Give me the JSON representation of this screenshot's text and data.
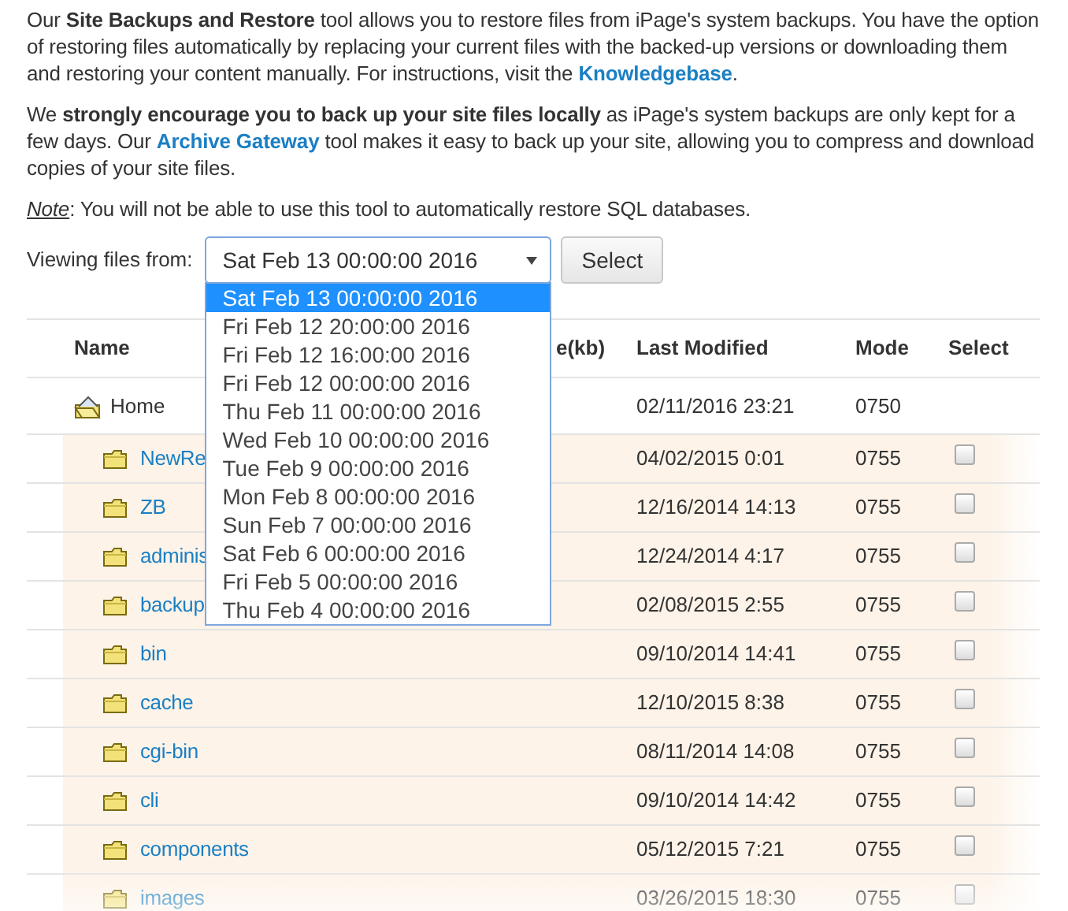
{
  "paragraphs": [
    {
      "segments": [
        {
          "kind": "text",
          "text": "Our **Site Backups and Restore** tool allows you to restore files from iPage's system backups. You have the option of restoring files automatically by replacing your current files with the backed-up versions or downloading them and restoring your content manually. For instructions, visit the "
        },
        {
          "kind": "link",
          "text": "Knowledgebase"
        },
        {
          "kind": "text",
          "text": "."
        }
      ]
    },
    {
      "segments": [
        {
          "kind": "text",
          "text": "We **strongly encourage you to back up your site files locally** as iPage's system backups are only kept for a few days. Our "
        },
        {
          "kind": "link",
          "text": "Archive Gateway"
        },
        {
          "kind": "text",
          "text": " tool makes it easy to back up your site, allowing you to compress and download copies of your site files."
        }
      ]
    },
    {
      "segments": [
        {
          "kind": "note-label",
          "text": "Note"
        },
        {
          "kind": "text",
          "text": ": You will not be able to use this tool to automatically restore SQL databases."
        }
      ]
    }
  ],
  "picker": {
    "label": "Viewing files from:",
    "value": "Sat Feb 13 00:00:00 2016",
    "expanded": true,
    "button": "Select",
    "options": [
      {
        "text": "Sat Feb 13 00:00:00 2016",
        "selected": true
      },
      {
        "text": "Fri Feb 12 20:00:00 2016",
        "selected": false
      },
      {
        "text": "Fri Feb 12 16:00:00 2016",
        "selected": false
      },
      {
        "text": "Fri Feb 12 00:00:00 2016",
        "selected": false
      },
      {
        "text": "Thu Feb 11 00:00:00 2016",
        "selected": false
      },
      {
        "text": "Wed Feb 10 00:00:00 2016",
        "selected": false
      },
      {
        "text": "Tue Feb 9 00:00:00 2016",
        "selected": false
      },
      {
        "text": "Mon Feb 8 00:00:00 2016",
        "selected": false
      },
      {
        "text": "Sun Feb 7 00:00:00 2016",
        "selected": false
      },
      {
        "text": "Sat Feb 6 00:00:00 2016",
        "selected": false
      },
      {
        "text": "Fri Feb 5 00:00:00 2016",
        "selected": false
      },
      {
        "text": "Thu Feb 4 00:00:00 2016",
        "selected": false
      }
    ]
  },
  "table": {
    "columns": [
      "Name",
      "e(kb)",
      "Last Modified",
      "Mode",
      "Select"
    ],
    "rows": [
      {
        "kind": "home",
        "name": "Home",
        "modified": "02/11/2016 23:21",
        "mode": "0750"
      },
      {
        "kind": "folder",
        "name": "NewRe",
        "modified": "04/02/2015 0:01",
        "mode": "0755",
        "checked": false
      },
      {
        "kind": "folder",
        "name": "ZB",
        "modified": "12/16/2014 14:13",
        "mode": "0755",
        "checked": false
      },
      {
        "kind": "folder",
        "name": "adminis",
        "modified": "12/24/2014 4:17",
        "mode": "0755",
        "checked": false
      },
      {
        "kind": "folder",
        "name": "backup",
        "modified": "02/08/2015 2:55",
        "mode": "0755",
        "checked": false
      },
      {
        "kind": "folder",
        "name": "bin",
        "modified": "09/10/2014 14:41",
        "mode": "0755",
        "checked": false
      },
      {
        "kind": "folder",
        "name": "cache",
        "modified": "12/10/2015 8:38",
        "mode": "0755",
        "checked": false
      },
      {
        "kind": "folder",
        "name": "cgi-bin",
        "modified": "08/11/2014 14:08",
        "mode": "0755",
        "checked": false
      },
      {
        "kind": "folder",
        "name": "cli",
        "modified": "09/10/2014 14:42",
        "mode": "0755",
        "checked": false
      },
      {
        "kind": "folder",
        "name": "components",
        "modified": "05/12/2015 7:21",
        "mode": "0755",
        "checked": false
      },
      {
        "kind": "folder",
        "name": "images",
        "modified": "03/26/2015 18:30",
        "mode": "0755",
        "checked": false
      }
    ]
  }
}
